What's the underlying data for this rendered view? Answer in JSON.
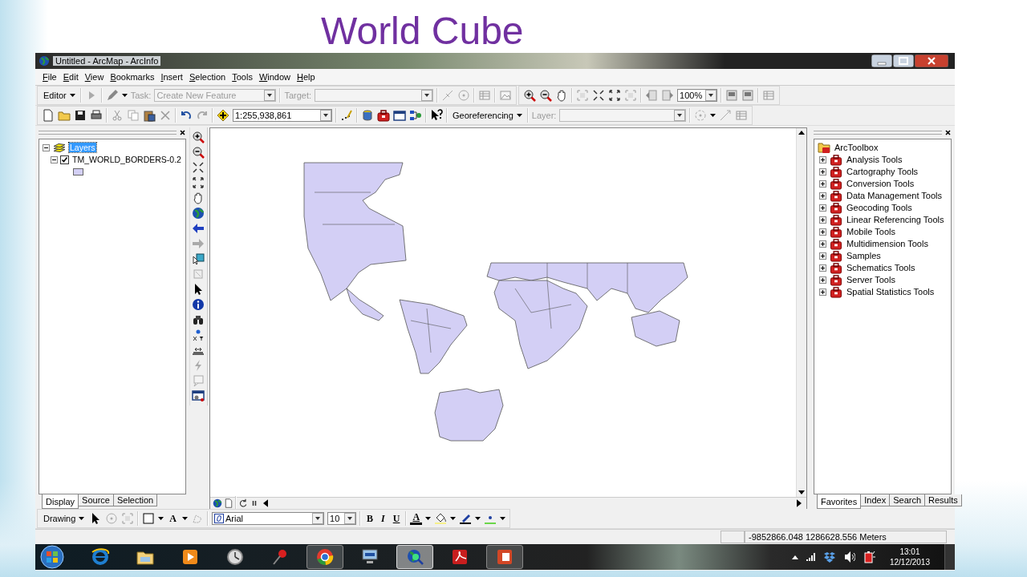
{
  "slide": {
    "title": "World Cube"
  },
  "window": {
    "title": "Untitled - ArcMap - ArcInfo"
  },
  "menu": [
    {
      "label": "File"
    },
    {
      "label": "Edit"
    },
    {
      "label": "View"
    },
    {
      "label": "Bookmarks"
    },
    {
      "label": "Insert"
    },
    {
      "label": "Selection"
    },
    {
      "label": "Tools"
    },
    {
      "label": "Window"
    },
    {
      "label": "Help"
    }
  ],
  "editor_toolbar": {
    "menu": "Editor",
    "task": {
      "label": "Task:",
      "value": "Create New Feature",
      "disabled": true
    },
    "target": {
      "label": "Target:",
      "disabled": true
    },
    "zoom_value": "100%"
  },
  "standard_toolbar": {
    "scale": "1:255,938,861",
    "georeferencing_menu": "Georeferencing",
    "layer": {
      "label": "Layer:",
      "disabled": true
    }
  },
  "toc": {
    "tree": [
      {
        "label": "Layers",
        "selected": true,
        "expanded": true,
        "children": [
          {
            "label": "TM_WORLD_BORDERS-0.2",
            "checked": true,
            "expanded": true
          }
        ]
      }
    ],
    "tabs": [
      {
        "label": "Display",
        "selected": true
      },
      {
        "label": "Source",
        "selected": false
      },
      {
        "label": "Selection",
        "selected": false
      }
    ]
  },
  "toolbox": {
    "root": "ArcToolbox",
    "items": [
      {
        "label": "Analysis Tools",
        "expanded": false
      },
      {
        "label": "Cartography Tools",
        "expanded": false
      },
      {
        "label": "Conversion Tools",
        "expanded": false
      },
      {
        "label": "Data Management Tools",
        "expanded": false
      },
      {
        "label": "Geocoding Tools",
        "expanded": false
      },
      {
        "label": "Linear Referencing Tools",
        "expanded": false
      },
      {
        "label": "Mobile Tools",
        "expanded": false
      },
      {
        "label": "Multidimension Tools",
        "expanded": false
      },
      {
        "label": "Samples",
        "expanded": false
      },
      {
        "label": "Schematics Tools",
        "expanded": false
      },
      {
        "label": "Server Tools",
        "expanded": false
      },
      {
        "label": "Spatial Statistics Tools",
        "expanded": false
      }
    ],
    "tabs": [
      {
        "label": "Favorites",
        "selected": true
      },
      {
        "label": "Index",
        "selected": false
      },
      {
        "label": "Search",
        "selected": false
      },
      {
        "label": "Results",
        "selected": false
      }
    ]
  },
  "drawing_toolbar": {
    "menu": "Drawing",
    "text_tool": "A",
    "font": "Arial",
    "size": "10",
    "bold": "B",
    "italic": "I",
    "underline": "U",
    "font_color": "A"
  },
  "status_bar": {
    "coordinates": "-9852866.048  1286628.556 Meters"
  },
  "taskbar": {
    "apps": [
      {
        "running": false,
        "selected": false
      },
      {
        "running": false,
        "selected": false
      },
      {
        "running": false,
        "selected": false
      },
      {
        "running": false,
        "selected": false
      },
      {
        "running": false,
        "selected": false
      },
      {
        "running": true,
        "selected": false
      },
      {
        "running": false,
        "selected": false
      },
      {
        "running": true,
        "selected": true
      },
      {
        "running": false,
        "selected": false
      },
      {
        "running": true,
        "selected": false
      }
    ],
    "time": "13:01",
    "date": "12/12/2013"
  }
}
